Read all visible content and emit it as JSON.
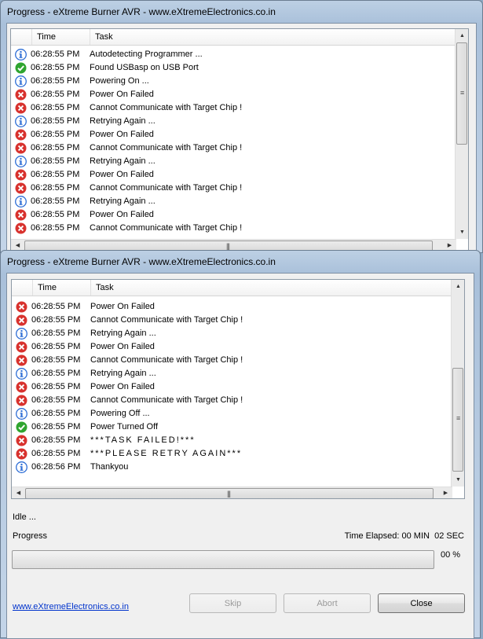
{
  "window_title": "Progress - eXtreme Burner AVR - www.eXtremeElectronics.co.in",
  "columns": {
    "time": "Time",
    "task": "Task"
  },
  "log_top": [
    {
      "icon": "info",
      "time": "06:28:55 PM",
      "task": "Autodetecting Programmer ..."
    },
    {
      "icon": "ok",
      "time": "06:28:55 PM",
      "task": "Found USBasp on USB Port"
    },
    {
      "icon": "info",
      "time": "06:28:55 PM",
      "task": "Powering On ..."
    },
    {
      "icon": "error",
      "time": "06:28:55 PM",
      "task": "Power On Failed"
    },
    {
      "icon": "error",
      "time": "06:28:55 PM",
      "task": "Cannot Communicate with Target Chip !"
    },
    {
      "icon": "info",
      "time": "06:28:55 PM",
      "task": "Retrying Again ..."
    },
    {
      "icon": "error",
      "time": "06:28:55 PM",
      "task": "Power On Failed"
    },
    {
      "icon": "error",
      "time": "06:28:55 PM",
      "task": "Cannot Communicate with Target Chip !"
    },
    {
      "icon": "info",
      "time": "06:28:55 PM",
      "task": "Retrying Again ..."
    },
    {
      "icon": "error",
      "time": "06:28:55 PM",
      "task": "Power On Failed"
    },
    {
      "icon": "error",
      "time": "06:28:55 PM",
      "task": "Cannot Communicate with Target Chip !"
    },
    {
      "icon": "info",
      "time": "06:28:55 PM",
      "task": "Retrying Again ..."
    },
    {
      "icon": "error",
      "time": "06:28:55 PM",
      "task": "Power On Failed"
    },
    {
      "icon": "error",
      "time": "06:28:55 PM",
      "task": "Cannot Communicate with Target Chip !"
    }
  ],
  "log_bottom": [
    {
      "icon": "error",
      "time": "06:28:55 PM",
      "task": "Power On Failed"
    },
    {
      "icon": "error",
      "time": "06:28:55 PM",
      "task": "Cannot Communicate with Target Chip !"
    },
    {
      "icon": "info",
      "time": "06:28:55 PM",
      "task": "Retrying Again ..."
    },
    {
      "icon": "error",
      "time": "06:28:55 PM",
      "task": "Power On Failed"
    },
    {
      "icon": "error",
      "time": "06:28:55 PM",
      "task": "Cannot Communicate with Target Chip !"
    },
    {
      "icon": "info",
      "time": "06:28:55 PM",
      "task": "Retrying Again ..."
    },
    {
      "icon": "error",
      "time": "06:28:55 PM",
      "task": "Power On Failed"
    },
    {
      "icon": "error",
      "time": "06:28:55 PM",
      "task": "Cannot Communicate with Target Chip !"
    },
    {
      "icon": "info",
      "time": "06:28:55 PM",
      "task": "Powering Off ..."
    },
    {
      "icon": "ok",
      "time": "06:28:55 PM",
      "task": "Power Turned Off"
    },
    {
      "icon": "error",
      "time": "06:28:55 PM",
      "task": "***TASK FAILED!***",
      "spaced": true
    },
    {
      "icon": "error",
      "time": "06:28:55 PM",
      "task": "***PLEASE RETRY AGAIN***",
      "spaced": true
    },
    {
      "icon": "info",
      "time": "06:28:56 PM",
      "task": "Thankyou"
    }
  ],
  "status": {
    "state": "Idle ...",
    "progress_label": "Progress",
    "time_elapsed": "Time Elapsed: 00 MIN  02 SEC",
    "percent_text": "00 %",
    "percent": 0
  },
  "buttons": {
    "skip": "Skip",
    "abort": "Abort",
    "close": "Close"
  },
  "link": "www.eXtremeElectronics.co.in",
  "colors": {
    "info": "#2f6fd6",
    "ok": "#2fa52f",
    "error": "#d8322e",
    "progress": "#5fc95f"
  }
}
